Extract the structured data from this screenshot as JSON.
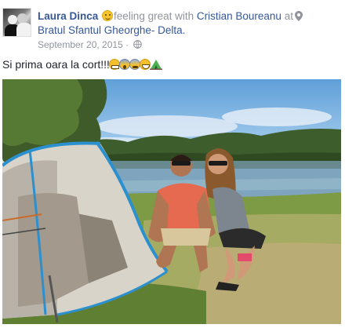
{
  "post": {
    "author_name": "Laura Dinca",
    "feeling_text": "feeling great with",
    "tagged_friend": "Cristian Boureanu",
    "at_word": "at",
    "location": "Bratul Sfantul Gheorghe- Delta.",
    "date": "September 20, 2015",
    "separator": "·",
    "status_text": "Si prima oara la cort!!!",
    "status_emojis": [
      "grimacing-face-icon",
      "face-screaming-icon",
      "fearful-face-icon",
      "smiling-face-icon",
      "camping-icon"
    ],
    "privacy_icon": "globe-icon",
    "location_icon": "map-pin-icon",
    "feeling_icon": "smiley-face-icon"
  },
  "photo": {
    "description_icon": "post-photo"
  },
  "colors": {
    "name_link": "#365899",
    "muted": "#90949c",
    "text": "#1d2129"
  }
}
